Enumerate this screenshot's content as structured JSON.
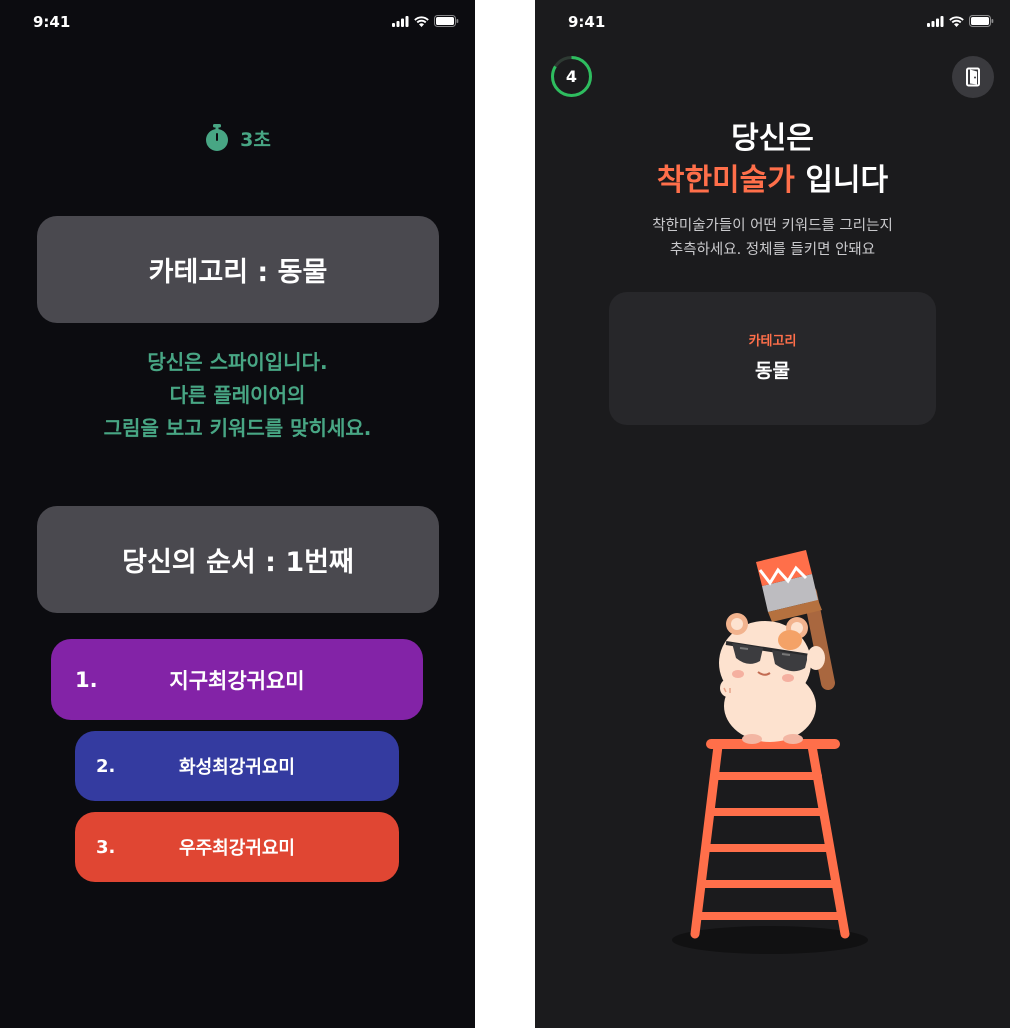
{
  "status_bar": {
    "time": "9:41"
  },
  "left_screen": {
    "timer_text": "3초",
    "category_text": "카테고리 : 동물",
    "spy_message": [
      "당신은 스파이입니다.",
      "다른 플레이어의",
      "그림을 보고 키워드를 맞히세요."
    ],
    "order_text": "당신의 순서 : 1번째",
    "players": [
      {
        "number": "1.",
        "name": "지구최강귀요미",
        "color": "#8323a7"
      },
      {
        "number": "2.",
        "name": "화성최강귀요미",
        "color": "#343ba0"
      },
      {
        "number": "3.",
        "name": "우주최강귀요미",
        "color": "#e04633"
      }
    ],
    "accent_color": "#48a684"
  },
  "right_screen": {
    "countdown": "4",
    "role_title_prefix": "당신은",
    "role_name": "착한미술가",
    "role_title_suffix": "입니다",
    "description": [
      "착한미술가들이 어떤 키워드를 그리는지",
      "추측하세요. 정체를 들키면 안돼요"
    ],
    "category_label": "카테고리",
    "category_value": "동물",
    "accent_color": "#ff6f4a",
    "icons": [
      "timer-ring-icon",
      "exit-door-icon",
      "hamster-painter-illustration"
    ]
  }
}
